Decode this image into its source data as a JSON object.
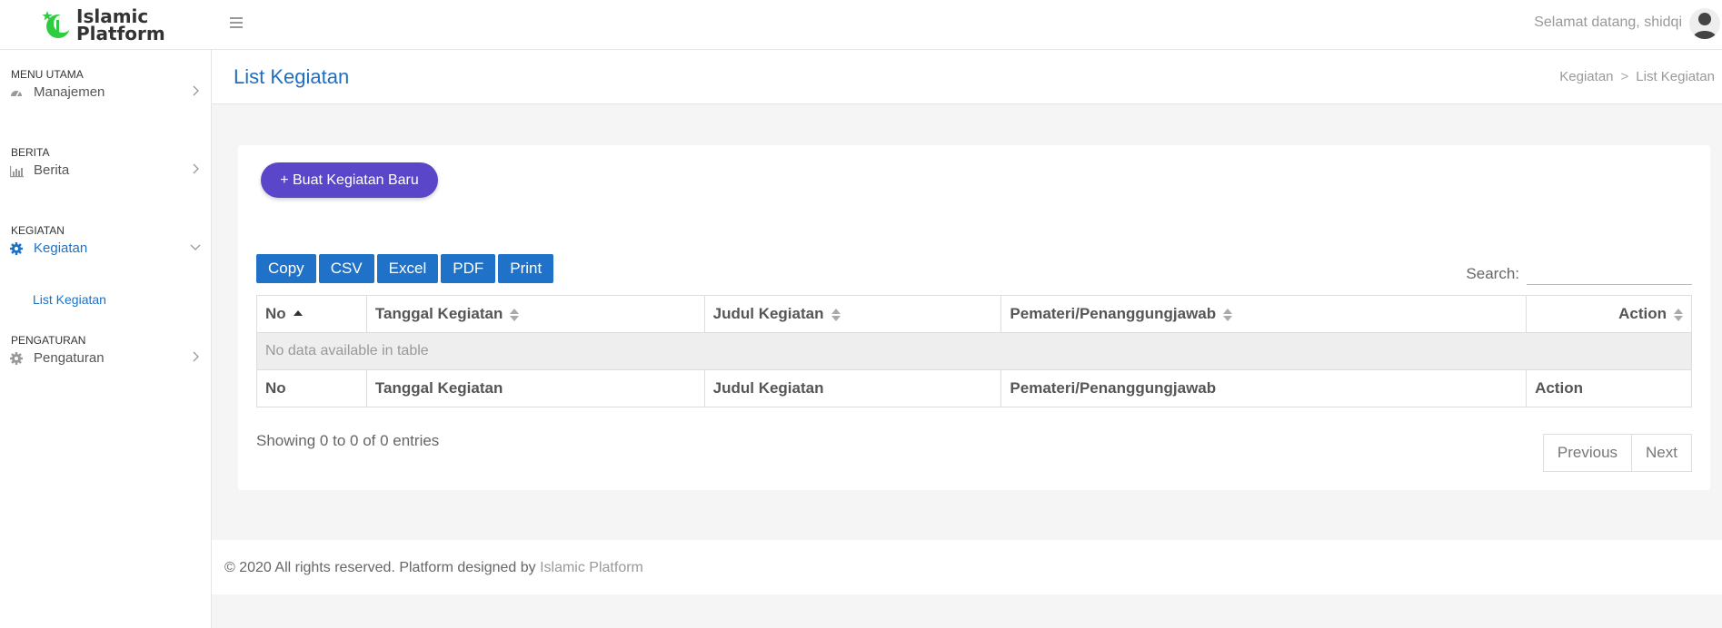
{
  "app": {
    "logo_line1": "Islamic",
    "logo_line2": "Platform",
    "welcome": "Selamat datang, shidqi"
  },
  "sidebar": {
    "sections": [
      {
        "title": "MENU UTAMA",
        "item": {
          "label": "Manajemen",
          "icon": "dashboard-icon"
        }
      },
      {
        "title": "BERITA",
        "item": {
          "label": "Berita",
          "icon": "bar-chart-icon"
        }
      },
      {
        "title": "KEGIATAN",
        "item": {
          "label": "Kegiatan",
          "icon": "gear-icon"
        },
        "subitems": [
          "List Kegiatan"
        ]
      },
      {
        "title": "PENGATURAN",
        "item": {
          "label": "Pengaturan",
          "icon": "gear-icon"
        }
      }
    ]
  },
  "page": {
    "title": "List Kegiatan",
    "breadcrumb": [
      "Kegiatan",
      "List Kegiatan"
    ]
  },
  "actions": {
    "new_button": "+ Buat Kegiatan Baru",
    "export_buttons": [
      "Copy",
      "CSV",
      "Excel",
      "PDF",
      "Print"
    ],
    "search_label": "Search:",
    "search_value": ""
  },
  "table": {
    "columns": [
      "No",
      "Tanggal Kegiatan",
      "Judul Kegiatan",
      "Pemateri/Penanggungjawab",
      "Action"
    ],
    "empty_message": "No data available in table",
    "info": "Showing 0 to 0 of 0 entries",
    "previous": "Previous",
    "next": "Next"
  },
  "footer": {
    "text": "© 2020 All rights reserved. Platform designed by ",
    "link": "Islamic Platform"
  },
  "colors": {
    "primary_blue": "#1f72c8",
    "new_button_purple": "#5a46c8",
    "logo_green": "#2ecc40"
  }
}
